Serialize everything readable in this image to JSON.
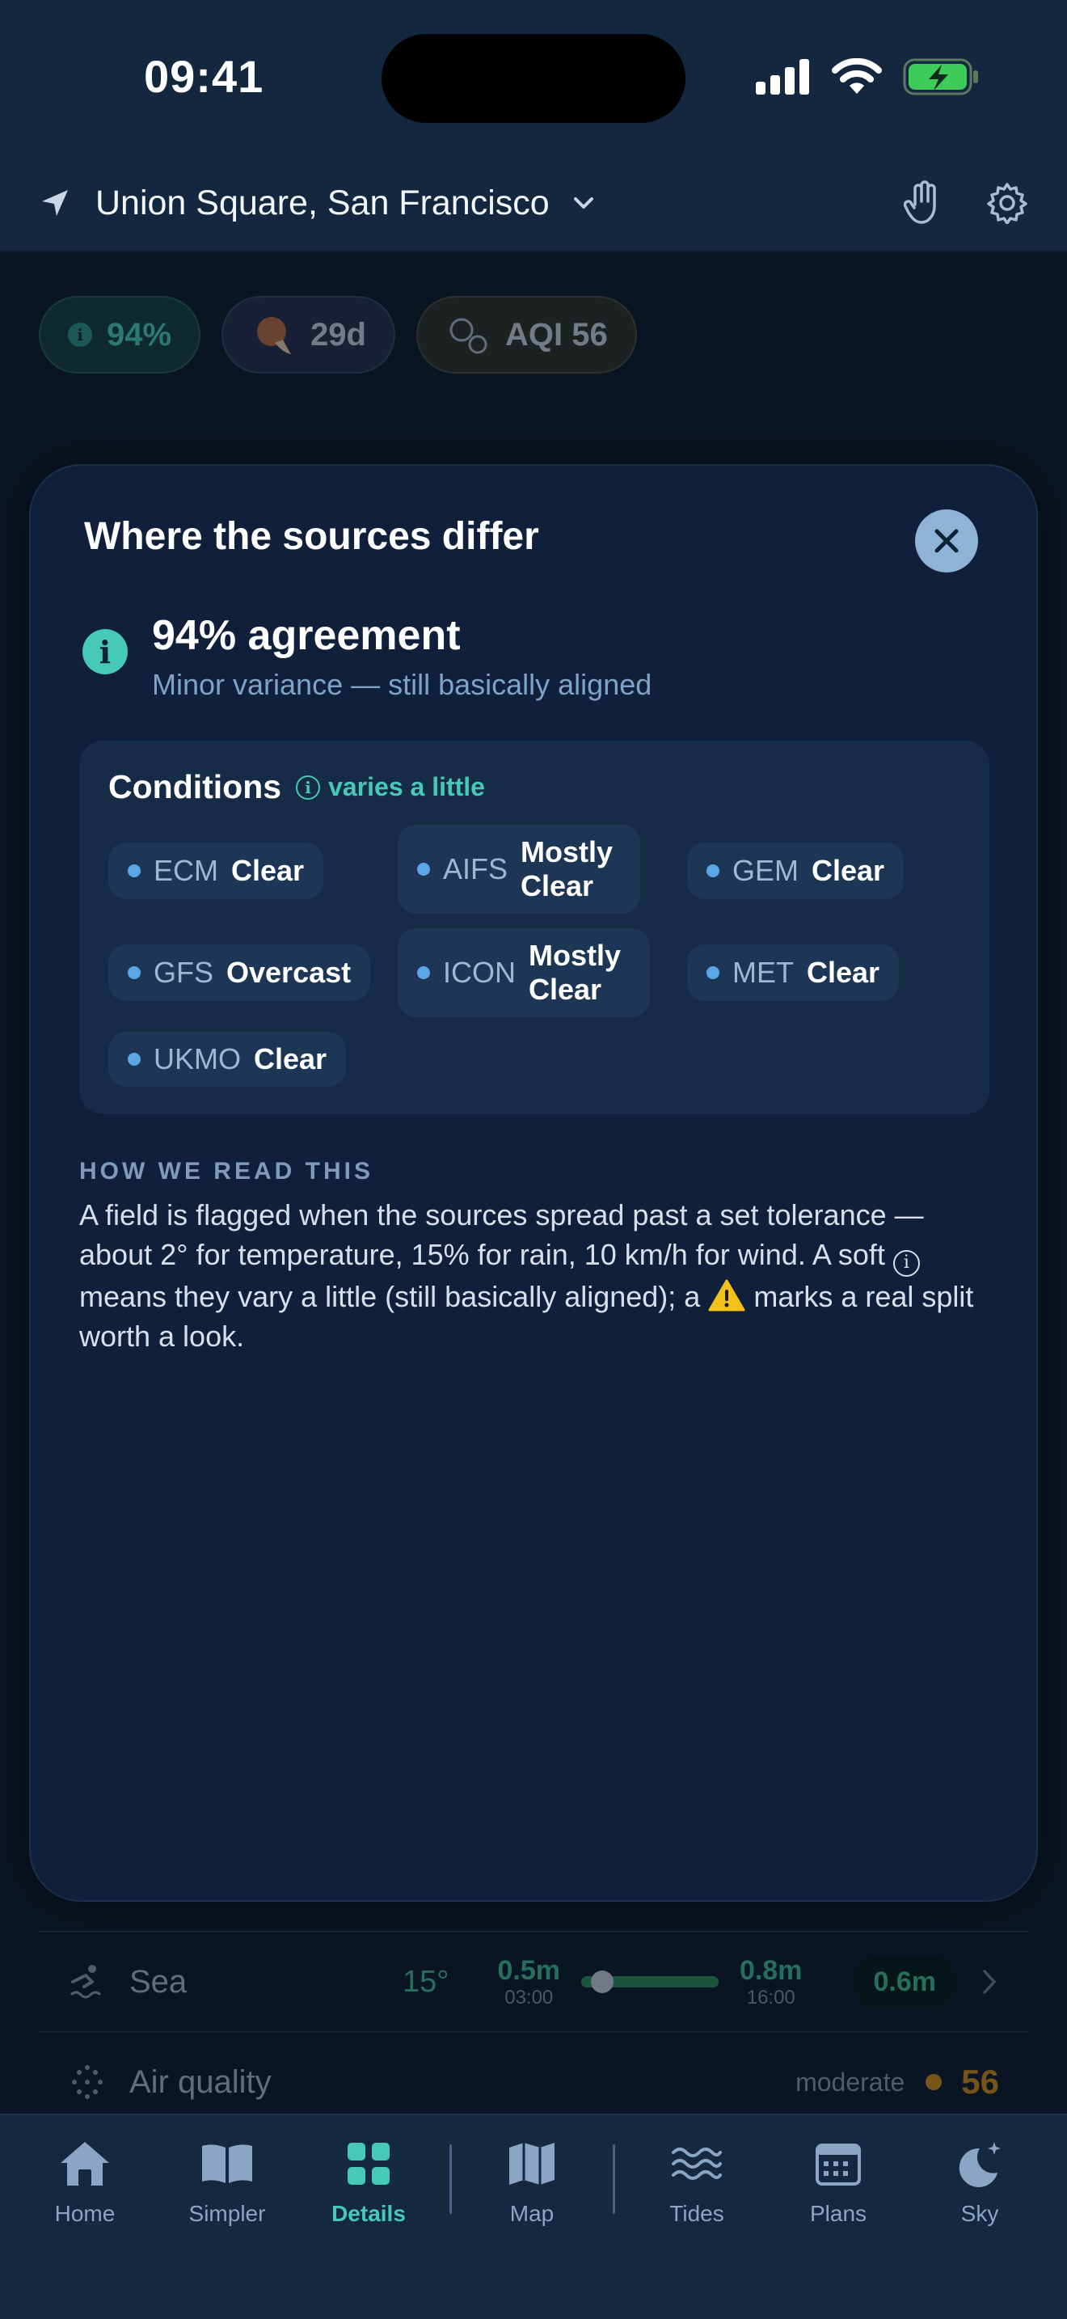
{
  "status_bar": {
    "time": "09:41"
  },
  "header": {
    "location": "Union Square, San Francisco"
  },
  "background_chips": {
    "agreement": "94%",
    "moon": "29d",
    "aqi": "AQI 56"
  },
  "sheet": {
    "title": "Where the sources differ",
    "agreement_value": "94% agreement",
    "agreement_sub": "Minor variance — still basically aligned",
    "conditions": {
      "title": "Conditions",
      "varies_label": "varies a little",
      "sources": [
        {
          "name": "ECM",
          "value": "Clear"
        },
        {
          "name": "AIFS",
          "value": "Mostly Clear"
        },
        {
          "name": "GEM",
          "value": "Clear"
        },
        {
          "name": "GFS",
          "value": "Overcast"
        },
        {
          "name": "ICON",
          "value": "Mostly Clear"
        },
        {
          "name": "MET",
          "value": "Clear"
        },
        {
          "name": "UKMO",
          "value": "Clear"
        }
      ]
    },
    "how_we_read": {
      "label": "HOW WE READ THIS",
      "part1": "A field is flagged when the sources spread past a set tolerance — about 2° for temperature, 15% for rain, 10 km/h for wind. A soft ",
      "part2": " means they vary a little (still basically aligned); a ",
      "part3": " marks a real split worth a look."
    }
  },
  "background_list": {
    "sea": {
      "label": "Sea",
      "temp": "15°",
      "low_value": "0.5m",
      "low_time": "03:00",
      "high_value": "0.8m",
      "high_time": "16:00",
      "current": "0.6m"
    },
    "air_quality": {
      "label": "Air quality",
      "level": "moderate",
      "value": "56"
    }
  },
  "tabs": [
    {
      "label": "Home"
    },
    {
      "label": "Simpler"
    },
    {
      "label": "Details"
    },
    {
      "label": "Map"
    },
    {
      "label": "Tides"
    },
    {
      "label": "Plans"
    },
    {
      "label": "Sky"
    }
  ],
  "colors": {
    "accent": "#46c9b6",
    "background": "#0a1524",
    "sheet": "#10203a",
    "aqi_moderate": "#d08a12",
    "sea_green": "#3fb88a"
  }
}
